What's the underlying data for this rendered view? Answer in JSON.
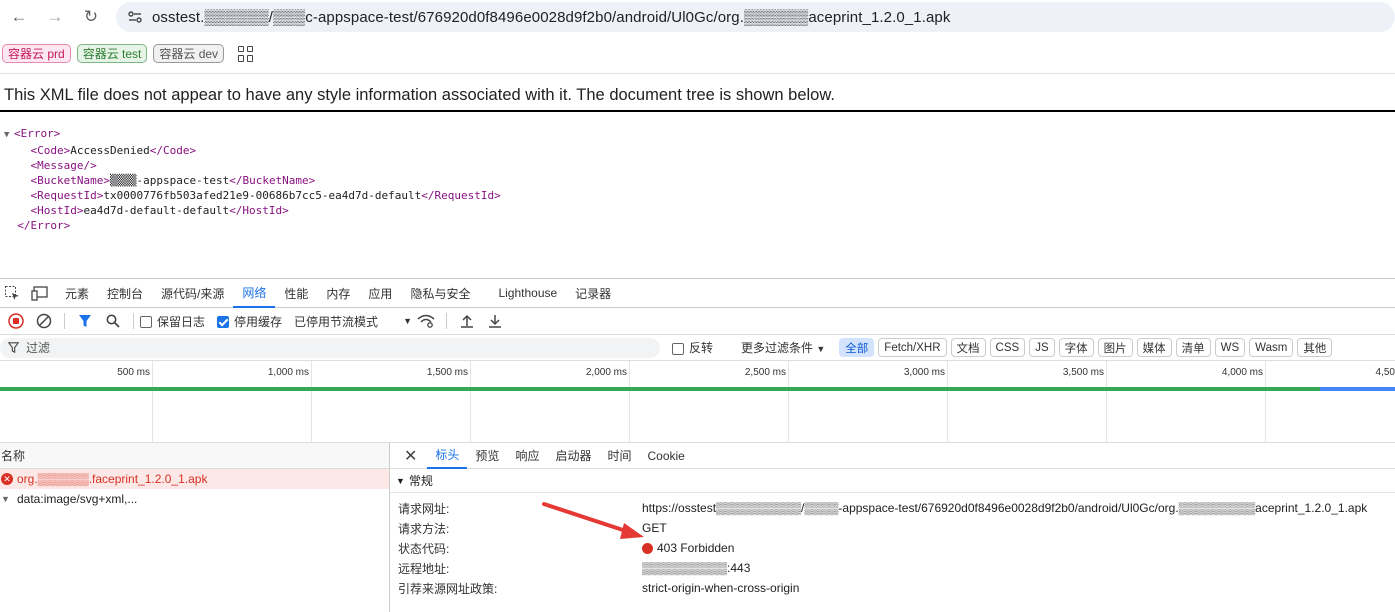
{
  "address_bar": {
    "url": "osstest.▒▒▒▒▒▒/▒▒▒c-appspace-test/676920d0f8496e0028d9f2b0/android/Ul0Gc/org.▒▒▒▒▒▒aceprint_1.2.0_1.apk"
  },
  "bookmarks": [
    {
      "label": "容器云 prd"
    },
    {
      "label": "容器云 test"
    },
    {
      "label": "容器云 dev"
    }
  ],
  "xml_page": {
    "banner": "This XML file does not appear to have any style information associated with it. The document tree is shown below.",
    "lines": {
      "error_open": "<Error>",
      "code_open": "<Code>",
      "code_val": "AccessDenied",
      "code_close": "</Code>",
      "message": "<Message/>",
      "bucket_open": "<BucketName>",
      "bucket_val": "▒▒▒▒-appspace-test",
      "bucket_close": "</BucketName>",
      "reqid_open": "<RequestId>",
      "reqid_val": "tx0000776fb503afed21e9-00686b7cc5-ea4d7d-default",
      "reqid_close": "</RequestId>",
      "hostid_open": "<HostId>",
      "hostid_val": "ea4d7d-default-default",
      "hostid_close": "</HostId>",
      "error_close": "</Error>"
    }
  },
  "devtools": {
    "tabs": [
      "元素",
      "控制台",
      "源代码/来源",
      "网络",
      "性能",
      "内存",
      "应用",
      "隐私与安全",
      "Lighthouse",
      "记录器"
    ],
    "active_tab": "网络",
    "toolbar": {
      "preserve_log": "保留日志",
      "disable_cache": "停用缓存",
      "throttle": "已停用节流模式"
    },
    "filter": {
      "placeholder": "过滤",
      "invert": "反转",
      "more_filters": "更多过滤条件",
      "chips": [
        "全部",
        "Fetch/XHR",
        "文档",
        "CSS",
        "JS",
        "字体",
        "图片",
        "媒体",
        "清单",
        "WS",
        "Wasm",
        "其他"
      ]
    },
    "timeline_ticks": [
      "500 ms",
      "1,000 ms",
      "1,500 ms",
      "2,000 ms",
      "2,500 ms",
      "3,000 ms",
      "3,500 ms",
      "4,000 ms",
      "4,50"
    ],
    "requests": {
      "header": "名称",
      "rows": [
        {
          "name": "org.▒▒▒▒▒▒.faceprint_1.2.0_1.apk",
          "error": true
        },
        {
          "name": "data:image/svg+xml,...",
          "error": false
        }
      ]
    },
    "detail": {
      "tabs": [
        "标头",
        "预览",
        "响应",
        "启动器",
        "时间",
        "Cookie"
      ],
      "active_tab": "标头",
      "section": "常规",
      "fields": [
        {
          "key": "请求网址:",
          "value": "https://osstest▒▒▒▒▒▒▒▒▒▒/▒▒▒▒-appspace-test/676920d0f8496e0028d9f2b0/android/Ul0Gc/org.▒▒▒▒▒▒▒▒▒aceprint_1.2.0_1.apk"
        },
        {
          "key": "请求方法:",
          "value": "GET"
        },
        {
          "key": "状态代码:",
          "value": "403 Forbidden"
        },
        {
          "key": "远程地址:",
          "value": "▒▒▒▒▒▒▒▒▒▒:443"
        },
        {
          "key": "引荐来源网址政策:",
          "value": "strict-origin-when-cross-origin"
        }
      ]
    },
    "colors": {
      "accent": "#1a73e8",
      "error": "#d93025",
      "waterfall_green": "#34a853",
      "waterfall_blue": "#4285f4"
    }
  }
}
